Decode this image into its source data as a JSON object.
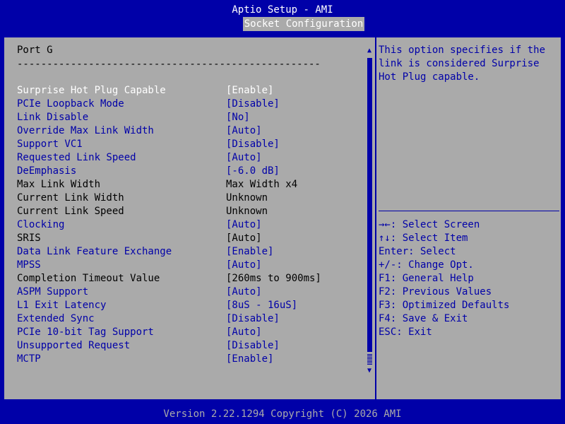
{
  "app_title": "Aptio Setup - AMI",
  "tab_label": "Socket Configuration",
  "section_title": "Port G",
  "separator": "---------------------------------------------------",
  "settings": [
    {
      "label": "Surprise Hot Plug Capable",
      "value": "[Enable]"
    },
    {
      "label": "PCIe Loopback Mode",
      "value": "[Disable]"
    },
    {
      "label": "Link Disable",
      "value": "[No]"
    },
    {
      "label": "Override Max Link Width",
      "value": "[Auto]"
    },
    {
      "label": "Support VC1",
      "value": "[Disable]"
    },
    {
      "label": "Requested Link Speed",
      "value": "[Auto]"
    },
    {
      "label": "DeEmphasis",
      "value": "[-6.0 dB]"
    },
    {
      "label": "Max Link Width",
      "value": "Max Width x4"
    },
    {
      "label": "Current Link Width",
      "value": "Unknown"
    },
    {
      "label": "Current Link Speed",
      "value": "Unknown"
    },
    {
      "label": "Clocking",
      "value": "[Auto]"
    },
    {
      "label": "SRIS",
      "value": "[Auto]"
    },
    {
      "label": "Data Link Feature Exchange",
      "value": "[Enable]"
    },
    {
      "label": "MPSS",
      "value": "[Auto]"
    },
    {
      "label": "Completion Timeout Value",
      "value": "[260ms to 900ms]"
    },
    {
      "label": "ASPM Support",
      "value": "[Auto]"
    },
    {
      "label": "L1 Exit Latency",
      "value": "[8uS - 16uS]"
    },
    {
      "label": "Extended Sync",
      "value": "[Disable]"
    },
    {
      "label": "PCIe 10-bit Tag Support",
      "value": "[Auto]"
    },
    {
      "label": "Unsupported Request",
      "value": "[Disable]"
    },
    {
      "label": "MCTP",
      "value": "[Enable]"
    }
  ],
  "help_text": "This option specifies if the\nlink is considered Surprise\nHot Plug capable.",
  "keys": [
    "→←: Select Screen",
    "↑↓: Select Item",
    "Enter: Select",
    "+/-: Change Opt.",
    "F1: General Help",
    "F2: Previous Values",
    "F3: Optimized Defaults",
    "F4: Save & Exit",
    "ESC: Exit"
  ],
  "version": "Version 2.22.1294 Copyright (C) 2026 AMI",
  "scroll_up_glyph": "▲",
  "scroll_down_glyph": "▼",
  "colors": {
    "background": "#0000a8",
    "panel": "#aaaaaa",
    "selected_text": "#ffffff",
    "editable_text": "#0000a8",
    "static_text": "#000000"
  }
}
